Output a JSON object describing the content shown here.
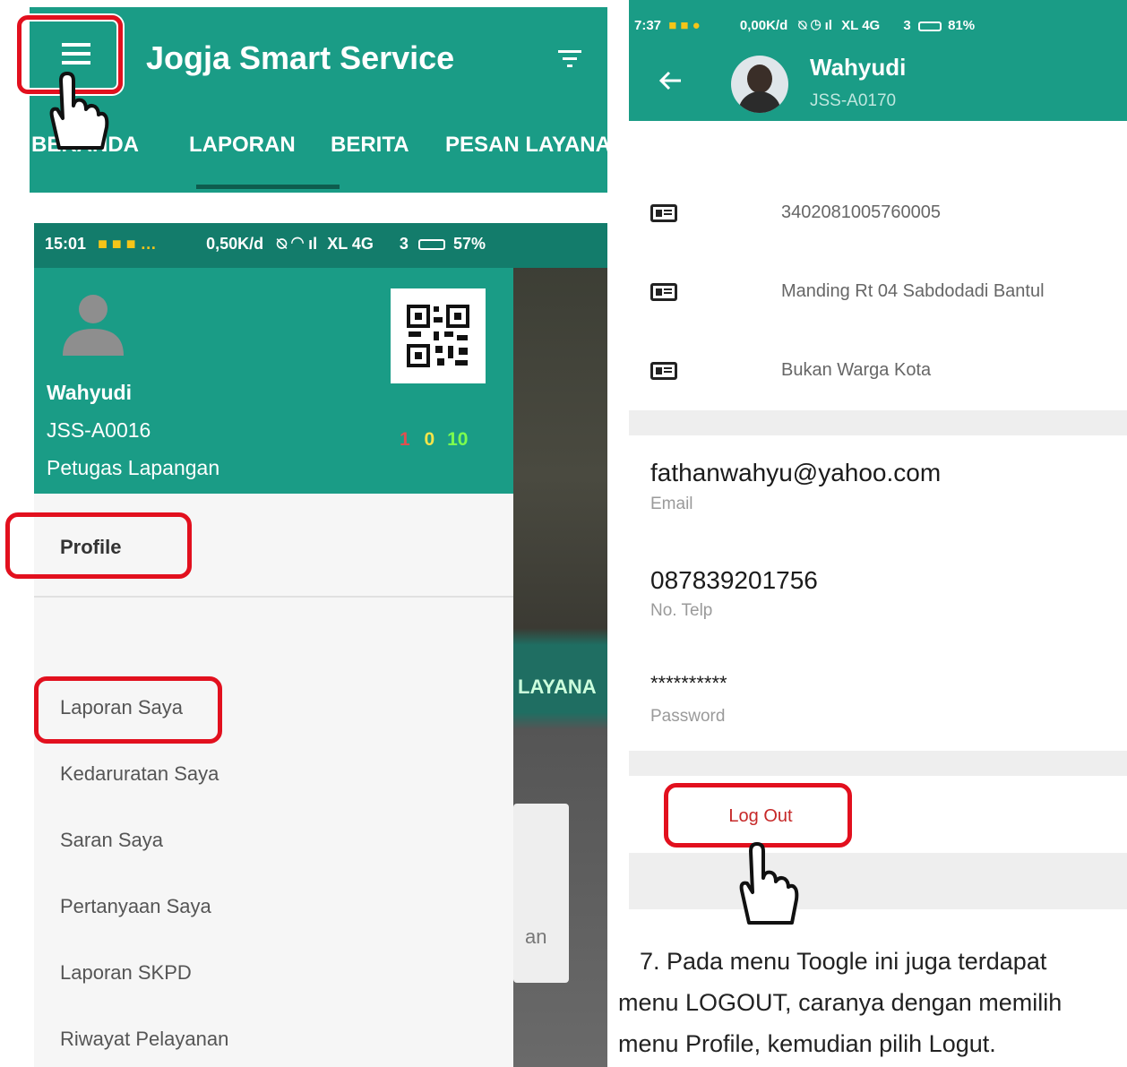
{
  "appbar": {
    "title": "Jogja Smart Service",
    "tabs": [
      "BERANDA",
      "LAPORAN",
      "BERITA",
      "PESAN LAYANA"
    ],
    "menu_icon": "hamburger-menu-icon",
    "filter_icon": "filter-icon"
  },
  "drawer": {
    "status": {
      "time": "15:01",
      "speed": "0,50K/d",
      "network": "XL 4G",
      "sim": "3",
      "battery": "57%"
    },
    "user": {
      "name": "Wahyudi",
      "id": "JSS-A0016",
      "role": "Petugas Lapangan"
    },
    "counters": {
      "red": "1",
      "yellow": "0",
      "green": "10"
    },
    "profile_label": "Profile",
    "items": [
      "Laporan Saya",
      "Kedaruratan Saya",
      "Saran Saya",
      "Pertanyaan Saya",
      "Laporan SKPD",
      "Riwayat Pelayanan"
    ],
    "behind_tab": "LAYANA",
    "behind_text": "an"
  },
  "profile": {
    "status": {
      "time": "7:37",
      "speed": "0,00K/d",
      "network": "XL 4G",
      "sim": "3",
      "battery": "81%"
    },
    "name": "Wahyudi",
    "id": "JSS-A0170",
    "nik": "3402081005760005",
    "address": "Manding Rt 04 Sabdodadi Bantul",
    "citizen": "Bukan Warga Kota",
    "email": "fathanwahyu@yahoo.com",
    "email_label": "Email",
    "phone": "087839201756",
    "phone_label": "No. Telp",
    "password": "**********",
    "password_label": "Password",
    "logout_label": "Log Out"
  },
  "caption": {
    "line1": "7.   Pada menu Toogle ini juga terdapat",
    "line2": "menu LOGOUT, caranya dengan memilih",
    "line3": "menu Profile, kemudian pilih Logut."
  },
  "colors": {
    "teal": "#1a9c86",
    "highlight": "#e2101e",
    "logout_text": "#c62828"
  }
}
